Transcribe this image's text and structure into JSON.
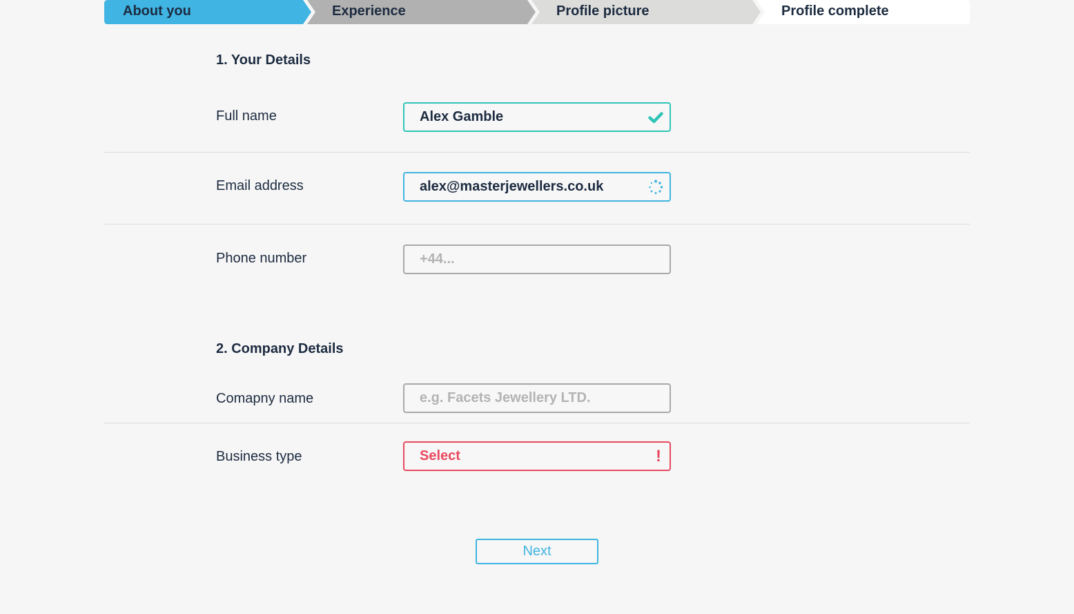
{
  "stepper": {
    "steps": [
      {
        "label": "About you",
        "state": "active",
        "color": "#40b4e3"
      },
      {
        "label": "Experience",
        "state": "pending",
        "color": "#b1b1b1"
      },
      {
        "label": "Profile picture",
        "state": "pending",
        "color": "#dcdcda"
      },
      {
        "label": "Profile complete",
        "state": "pending",
        "color": "#ffffff"
      }
    ]
  },
  "your_details": {
    "title": "1. Your Details",
    "full_name": {
      "label": "Full name",
      "value": "Alex Gamble",
      "status": "valid",
      "icon": "check-icon"
    },
    "email": {
      "label": "Email address",
      "value": "alex@masterjewellers.co.uk",
      "status": "loading",
      "icon": "spinner-icon"
    },
    "phone": {
      "label": "Phone number",
      "value": "",
      "placeholder": "+44..."
    }
  },
  "company_details": {
    "title": "2. Company Details",
    "company_name": {
      "label": "Comapny name",
      "value": "",
      "placeholder": "e.g. Facets Jewellery LTD."
    },
    "business_type": {
      "label": "Business type",
      "value": "Select",
      "status": "error",
      "error_mark": "!"
    }
  },
  "actions": {
    "next_label": "Next"
  },
  "colors": {
    "accent": "#40b4e3",
    "valid": "#2ec4b6",
    "error": "#e8485f",
    "text": "#1c2b40",
    "placeholder": "#b3b3b3"
  }
}
